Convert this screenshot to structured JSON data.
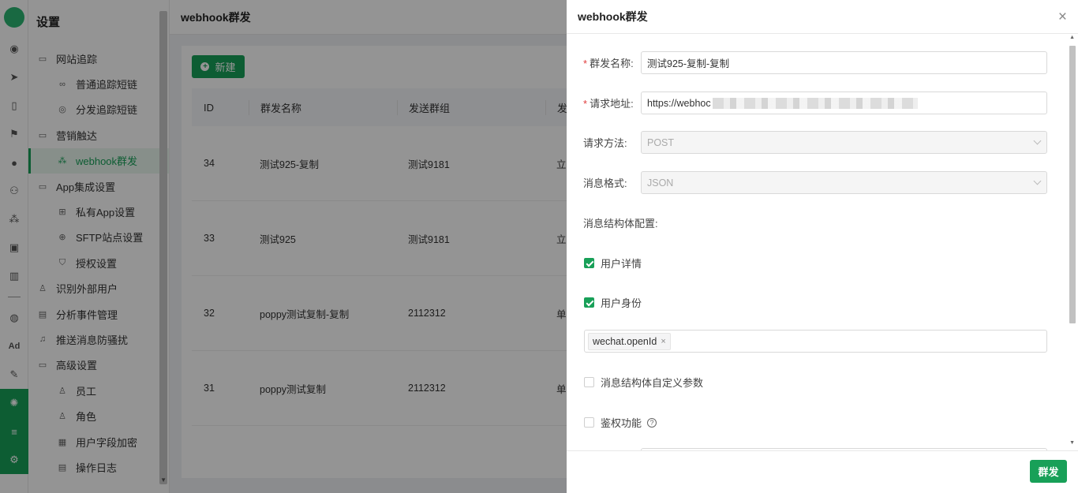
{
  "rail": {
    "icons": [
      "dashboard-icon",
      "send-icon",
      "phone-icon",
      "flag-icon",
      "user-icon",
      "users-icon",
      "cluster-icon",
      "bookmark-icon",
      "bar-chart-icon",
      "wechat-icon",
      "ad-icon",
      "wrench-icon",
      "webhook-icon",
      "server-icon",
      "gear-icon"
    ],
    "ad_label": "Ad"
  },
  "sidebar": {
    "title": "设置",
    "items": [
      {
        "label": "网站追踪",
        "level": 1,
        "icon": "folder-icon"
      },
      {
        "label": "普通追踪短链",
        "level": 2,
        "icon": "link-icon"
      },
      {
        "label": "分发追踪短链",
        "level": 2,
        "icon": "target-icon"
      },
      {
        "label": "营销触达",
        "level": 1,
        "icon": "folder-icon"
      },
      {
        "label": "webhook群发",
        "level": 2,
        "icon": "webhook-icon",
        "active": true
      },
      {
        "label": "App集成设置",
        "level": 1,
        "icon": "folder-icon"
      },
      {
        "label": "私有App设置",
        "level": 2,
        "icon": "grid-icon"
      },
      {
        "label": "SFTP站点设置",
        "level": 2,
        "icon": "globe-icon"
      },
      {
        "label": "授权设置",
        "level": 2,
        "icon": "shield-icon"
      },
      {
        "label": "识别外部用户",
        "level": 1,
        "icon": "user-search-icon"
      },
      {
        "label": "分析事件管理",
        "level": 1,
        "icon": "event-icon"
      },
      {
        "label": "推送消息防骚扰",
        "level": 1,
        "icon": "bell-off-icon"
      },
      {
        "label": "高级设置",
        "level": 1,
        "icon": "folder-icon"
      },
      {
        "label": "员工",
        "level": 2,
        "icon": "user-icon"
      },
      {
        "label": "角色",
        "level": 2,
        "icon": "role-icon"
      },
      {
        "label": "用户字段加密",
        "level": 2,
        "icon": "encrypt-icon"
      },
      {
        "label": "操作日志",
        "level": 2,
        "icon": "log-icon"
      }
    ]
  },
  "main": {
    "page_title": "webhook群发",
    "new_button": "新建",
    "table": {
      "headers": [
        "ID",
        "群发名称",
        "发送群组",
        "发"
      ],
      "rows": [
        [
          "34",
          "测试925-复制",
          "测试9181",
          "立"
        ],
        [
          "33",
          "测试925",
          "测试9181",
          "立"
        ],
        [
          "32",
          "poppy测试复制-复制",
          "2112312",
          "单"
        ],
        [
          "31",
          "poppy测试复制",
          "2112312",
          "单"
        ]
      ]
    }
  },
  "drawer": {
    "title": "webhook群发",
    "close": "×",
    "fields": {
      "name_label": "群发名称:",
      "name_value": "测试925-复制-复制",
      "url_label": "请求地址:",
      "url_value": "https://webhoc",
      "method_label": "请求方法:",
      "method_value": "POST",
      "format_label": "消息格式:",
      "format_value": "JSON"
    },
    "struct_section": "消息结构体配置:",
    "checkbox_user_detail": "用户详情",
    "checkbox_user_identity": "用户身份",
    "identity_tag": "wechat.openId",
    "tag_remove": "×",
    "checkbox_custom_params": "消息结构体自定义参数",
    "checkbox_auth": "鉴权功能",
    "help_glyph": "?",
    "submit_button": "群发",
    "accent": "#18a058"
  }
}
